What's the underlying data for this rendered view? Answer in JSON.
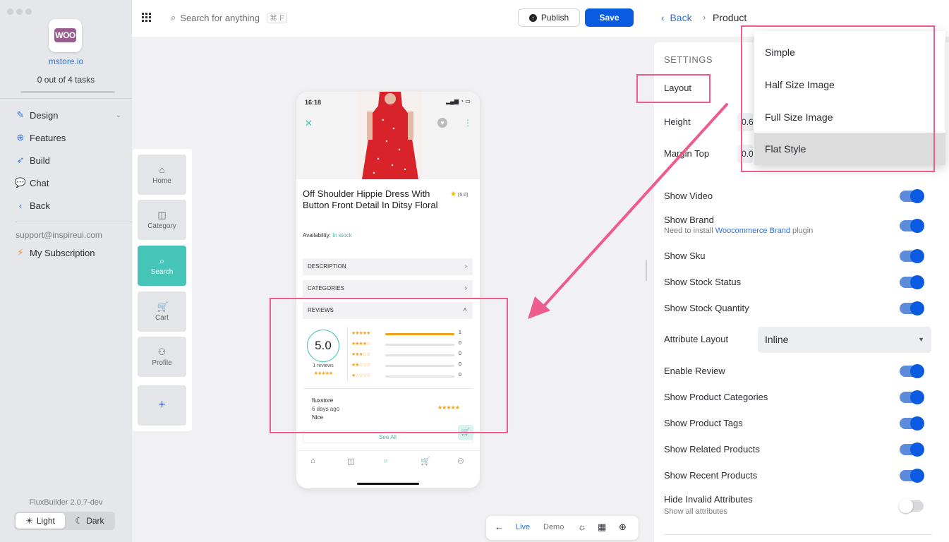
{
  "sidebar": {
    "store_name": "mstore.io",
    "tasks": "0 out of 4 tasks",
    "items": [
      {
        "label": "Design",
        "icon": "brush-icon"
      },
      {
        "label": "Features",
        "icon": "plus-circle-icon"
      },
      {
        "label": "Build",
        "icon": "rocket-icon"
      },
      {
        "label": "Chat",
        "icon": "chat-icon"
      },
      {
        "label": "Back",
        "icon": "chevron-left-icon"
      }
    ],
    "support_email": "support@inspireui.com",
    "subscription": "My Subscription",
    "version": "FluxBuilder 2.0.7-dev",
    "theme_light": "Light",
    "theme_dark": "Dark"
  },
  "topbar": {
    "search_placeholder": "Search for anything",
    "shortcut": "⌘ F",
    "publish": "Publish",
    "save": "Save"
  },
  "tabs": [
    {
      "label": "Home",
      "icon": "home-icon"
    },
    {
      "label": "Category",
      "icon": "category-icon"
    },
    {
      "label": "Search",
      "icon": "search-icon",
      "active": true
    },
    {
      "label": "Cart",
      "icon": "cart-icon"
    },
    {
      "label": "Profile",
      "icon": "profile-icon"
    }
  ],
  "phone": {
    "time": "16:18",
    "product_title": "Off Shoulder Hippie Dress With Button Front Detail In Ditsy Floral",
    "rating": "(5.0)",
    "availability_label": "Availability:",
    "availability_value": "In stock",
    "sections": [
      "DESCRIPTION",
      "CATEGORIES",
      "REVIEWS"
    ],
    "score": "5.0",
    "reviews_count": "1 reviews",
    "rating_rows": [
      {
        "stars": "★★★★★",
        "count": "1",
        "fraction": 1.0
      },
      {
        "stars": "★★★★☆",
        "count": "0",
        "fraction": 0
      },
      {
        "stars": "★★★☆☆",
        "count": "0",
        "fraction": 0
      },
      {
        "stars": "★★☆☆☆",
        "count": "0",
        "fraction": 0
      },
      {
        "stars": "★☆☆☆☆",
        "count": "0",
        "fraction": 0
      }
    ],
    "reviewer": "fluxstore",
    "review_date": "6 days ago",
    "review_text": "Nice",
    "see_all": "See All"
  },
  "preview_toolbar": {
    "live": "Live",
    "demo": "Demo"
  },
  "right": {
    "back": "Back",
    "crumb": "Product",
    "settings": "SETTINGS",
    "layout": "Layout",
    "height": "Height",
    "height_value": "0.6",
    "margin_top": "Margin Top",
    "margin_value": "0.0",
    "layout_options": [
      "Simple",
      "Half Size Image",
      "Full Size Image",
      "Flat Style"
    ],
    "selected_layout": "Flat Style",
    "toggles": [
      {
        "label": "Show Video",
        "on": true
      },
      {
        "label": "Show Brand",
        "on": true,
        "sub_pre": "Need to install ",
        "sub_link": "Woocommerce Brand",
        "sub_post": " plugin"
      },
      {
        "label": "Show Sku",
        "on": true
      },
      {
        "label": "Show Stock Status",
        "on": true
      },
      {
        "label": "Show Stock Quantity",
        "on": true
      },
      {
        "label": "Enable Review",
        "on": true
      },
      {
        "label": "Show Product Categories",
        "on": true
      },
      {
        "label": "Show Product Tags",
        "on": true
      },
      {
        "label": "Show Related Products",
        "on": true
      },
      {
        "label": "Show Recent Products",
        "on": true
      },
      {
        "label": "Hide Invalid Attributes",
        "on": false,
        "sub": "Show all attributes"
      }
    ],
    "attribute_layout_label": "Attribute Layout",
    "attribute_layout_value": "Inline"
  },
  "colors": {
    "accent": "#0a5be1",
    "teal": "#46c4b8",
    "annotation": "#ef5b8c",
    "star": "#f2a21a"
  }
}
